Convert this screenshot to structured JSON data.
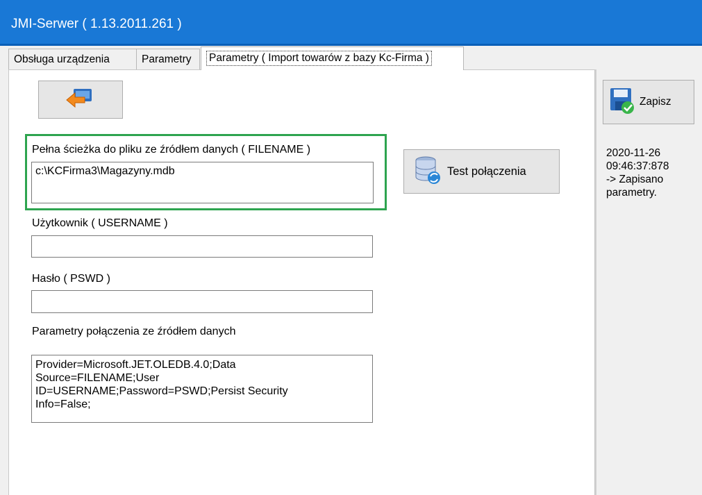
{
  "window": {
    "title": "JMI-Serwer ( 1.13.2011.261 )"
  },
  "tabs": [
    {
      "label": "Obsługa urządzenia"
    },
    {
      "label": "Parametry"
    },
    {
      "label": "Parametry ( Import towarów z bazy Kc-Firma )"
    }
  ],
  "form": {
    "filename_label": "Pełna ścieżka do pliku ze źródłem danych ( FILENAME )",
    "filename_value": "c:\\KCFirma3\\Magazyny.mdb",
    "username_label": "Użytkownik ( USERNAME )",
    "username_value": "",
    "password_label": "Hasło ( PSWD )",
    "password_value": "",
    "params_label": "Parametry połączenia ze źródłem danych",
    "params_value": "Provider=Microsoft.JET.OLEDB.4.0;Data\nSource=FILENAME;User\nID=USERNAME;Password=PSWD;Persist Security\nInfo=False;"
  },
  "buttons": {
    "back_icon": "arrow-back-icon",
    "test_label": "Test połączenia",
    "test_icon": "database-refresh-icon",
    "save_label": "Zapisz",
    "save_icon": "floppy-check-icon"
  },
  "log": {
    "text": "2020-11-26\n09:46:37:878\n-> Zapisano\nparametry."
  },
  "colors": {
    "titlebar": "#1978d6",
    "highlight_border": "#2ea44f"
  }
}
